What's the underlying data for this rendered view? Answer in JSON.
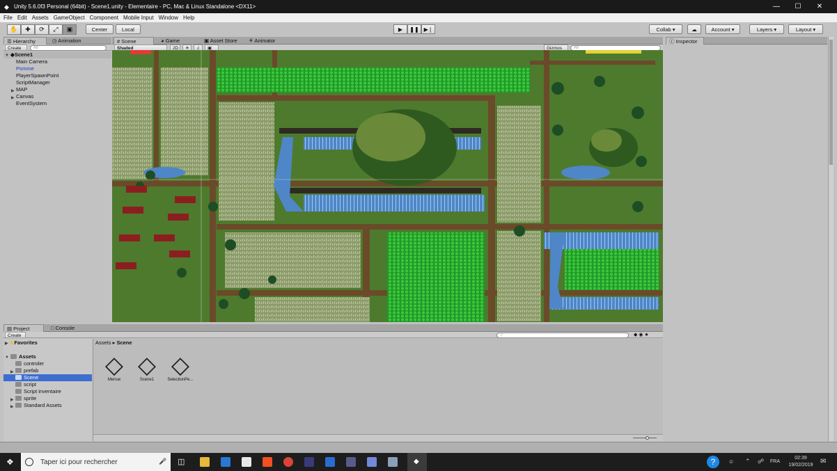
{
  "window": {
    "title": "Unity 5.6.0f3 Personal (64bit) - Scene1.unity - Elementaire - PC, Mac & Linux Standalone <DX11>",
    "minimize": "—",
    "maximize": "☐",
    "close": "✕"
  },
  "menu": [
    "File",
    "Edit",
    "Assets",
    "GameObject",
    "Component",
    "Mobile Input",
    "Window",
    "Help"
  ],
  "toolbar": {
    "pivot_center": "Center",
    "pivot_local": "Local",
    "collab": "Collab ▾",
    "account": "Account ▾",
    "layers": "Layers ▾",
    "layout": "Layout ▾"
  },
  "hierarchy": {
    "tab": "Hierarchy",
    "tab2": "Animation",
    "create": "Create ▾",
    "search_placeholder": "All",
    "scene_name": "Scene1",
    "items": [
      "Main Camera",
      "Pomme",
      "PlayerSpawnPoint",
      "ScriptManager",
      "MAP",
      "Canvas",
      "EventSystem"
    ]
  },
  "scene_tabs": {
    "scene": "Scene",
    "game": "Game",
    "asset_store": "Asset Store",
    "animator": "Animator",
    "shaded": "Shaded",
    "mode_2d": "2D",
    "gizmos": "Gizmos ▾",
    "search_placeholder": "All"
  },
  "inspector": {
    "tab": "Inspector"
  },
  "project": {
    "tab": "Project",
    "tab2": "Console",
    "create": "Create ▾",
    "favorites": "Favorites",
    "assets_root": "Assets",
    "breadcrumb_root": "Assets",
    "breadcrumb_current": "Scene",
    "folders": [
      "controler",
      "prefab",
      "Scene",
      "script",
      "Script inventaire",
      "sprite",
      "Standard Assets"
    ],
    "files": [
      "Menue",
      "Scene1",
      "SelectionPe..."
    ]
  },
  "taskbar": {
    "search_placeholder": "Taper ici pour rechercher",
    "lang": "FRA",
    "time": "02:39",
    "date": "19/02/2019"
  },
  "colors": {
    "unity_gray": "#c2c2c2",
    "selection_blue": "#3d6ecf",
    "taskbar": "#1d1d1d",
    "grass": "#4e7a2e",
    "path": "#6b4a2a",
    "water": "#4f86c8"
  }
}
